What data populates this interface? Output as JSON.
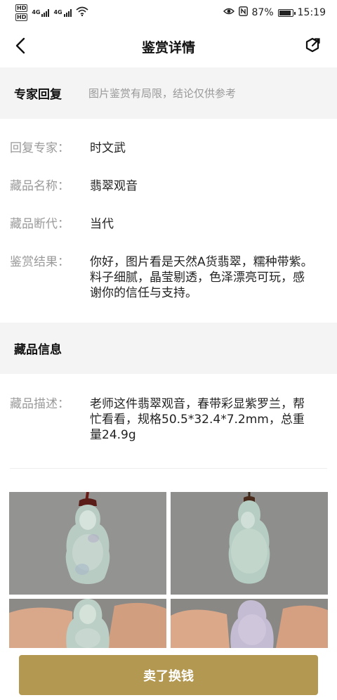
{
  "status_bar": {
    "hd1": "HD",
    "hd2": "HD",
    "net1": "4G",
    "net2": "4G",
    "battery_pct": "87%",
    "battery_level": 0.87,
    "time": "15:19"
  },
  "header": {
    "title": "鉴赏详情"
  },
  "expert_section": {
    "title": "专家回复",
    "note": "图片鉴赏有局限，结论仅供参考"
  },
  "expert_info": [
    {
      "label": "回复专家：",
      "value": "时文武"
    },
    {
      "label": "藏品名称：",
      "value": "翡翠观音"
    },
    {
      "label": "藏品断代：",
      "value": "当代"
    },
    {
      "label": "鉴赏结果：",
      "value": "你好，图片看是天然A货翡翠，糯种带紫。料子细腻，晶莹剔透，色泽漂亮可玩，感谢你的信任与支持。"
    }
  ],
  "item_section": {
    "title": "藏品信息"
  },
  "item_info": {
    "label": "藏品描述：",
    "value": "老师这件翡翠观音，春带彩显紫罗兰，帮忙看看，规格50.5*32.4*7.2mm，总重量24.9g"
  },
  "photos": [
    "photo-front",
    "photo-back",
    "photo-hand-front",
    "photo-hand-back"
  ],
  "bottom": {
    "sell_label": "卖了换钱",
    "button_color": "#b39852"
  }
}
